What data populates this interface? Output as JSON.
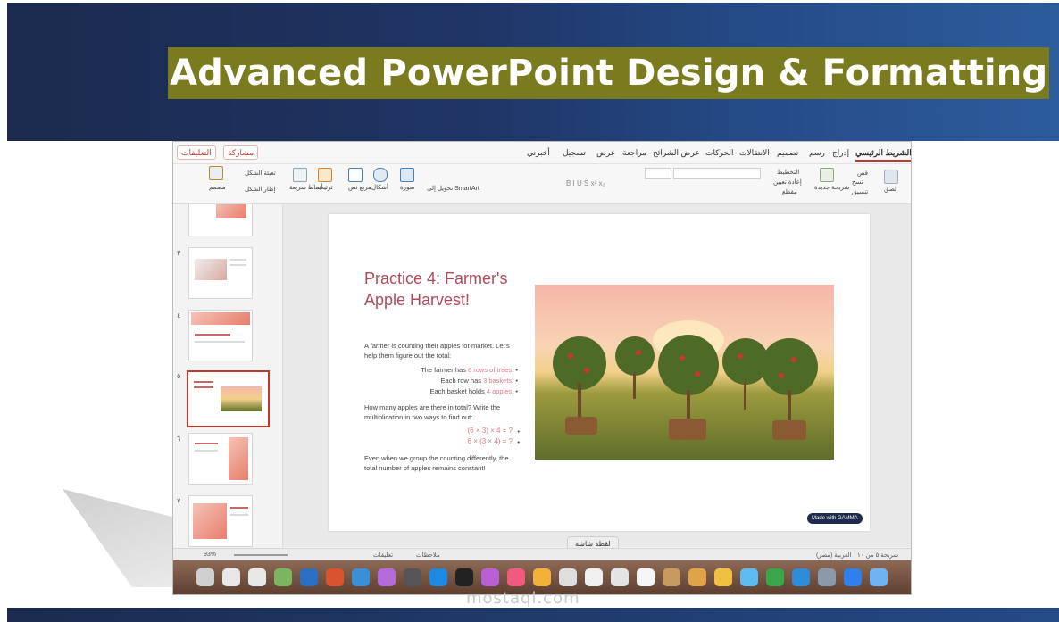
{
  "banner": {
    "title": "Advanced PowerPoint Design & Formatting"
  },
  "watermark": "mostaql.com",
  "ribbon_tabs": [
    "الشريط الرئيسي",
    "إدراج",
    "رسم",
    "تصميم",
    "الانتقالات",
    "الحركات",
    "عرض الشرائح",
    "مراجعة",
    "عرض",
    "تسجيل",
    "أخبرني"
  ],
  "share_label": "مشاركة",
  "comments_label": "التعليقات",
  "ribbon": {
    "paste": "لصق",
    "cut": "قص",
    "copy": "نسخ",
    "format": "تنسيق",
    "new_slide": "شريحة جديدة",
    "layout": "التخطيط",
    "reset": "إعادة تعيين",
    "section": "مقطع",
    "convert_smartart": "تحويل إلى SmartArt",
    "picture": "صورة",
    "shapes": "أشكال",
    "textbox": "مربع نص",
    "arrange": "ترتيب",
    "quick_styles": "أنماط سريعة",
    "shape_fill": "تعبئة الشكل",
    "shape_outline": "إطار الشكل",
    "designer": "مصمم"
  },
  "thumbnails": [
    {
      "num": "٣",
      "title": "Practice 3"
    },
    {
      "num": "٤",
      "title": "Practice 4: Numerical Equation Challenge!"
    },
    {
      "num": "٥",
      "title": "Practice 4: Farmer's Apple Harvest!"
    },
    {
      "num": "٦",
      "title": "Practice 5: Visual Multiplication with Dot Arrays!"
    },
    {
      "num": "٧",
      "title": "Bonus Challenge: Fit in the Store!"
    }
  ],
  "slide": {
    "title": "Practice 4: Farmer's Apple Harvest!",
    "intro": "A farmer is counting their apples for market. Let's help them figure out the total:",
    "bullets": [
      {
        "pre": "The farmer has ",
        "hl": "6 rows of trees",
        "post": "."
      },
      {
        "pre": "Each row has ",
        "hl": "3 baskets",
        "post": "."
      },
      {
        "pre": "Each basket holds ",
        "hl": "4 apples",
        "post": "."
      }
    ],
    "question": "How many apples are there in total? Write the multiplication in two ways to find out:",
    "math": [
      "(6 × 3) × 4 = ?",
      "6 × (3 × 4) = ?"
    ],
    "conclusion": "Even when we group the counting differently, the total number of apples remains constant!",
    "made_with": "Made with GAMMA"
  },
  "status": {
    "slide_of": "شريحة ٥ من ١٠",
    "language": "العربية (مصر)",
    "notes": "ملاحظات",
    "comments": "تعليقات",
    "zoom": "93%"
  },
  "tooltip": "لقطة شاشة",
  "dock_colors": [
    "#d0d0d0",
    "#e8e8e8",
    "#e8e8e8",
    "#7bb560",
    "#2b6fc4",
    "#d9532f",
    "#3a8fd6",
    "#b46ad8",
    "#555555",
    "#1e88e5",
    "#222222",
    "#b85fd6",
    "#f05a7e",
    "#f2b23a",
    "#dedede",
    "#f0f0f0",
    "#e4e4e4",
    "#f5f5f5",
    "#c79a60",
    "#e0a34a",
    "#f0c040",
    "#5dbbf2",
    "#3aa64a",
    "#2e8bd8",
    "#8a9aa8",
    "#2f80ed",
    "#6fb3f2"
  ]
}
